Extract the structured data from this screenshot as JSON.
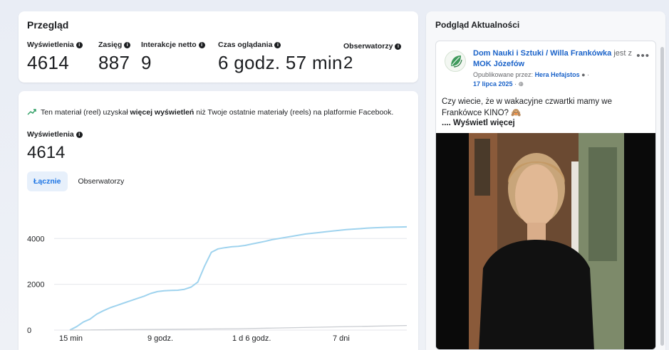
{
  "overview": {
    "title": "Przegląd",
    "metrics": [
      {
        "label": "Wyświetlenia",
        "value": "4614"
      },
      {
        "label": "Zasięg",
        "value": "887"
      },
      {
        "label": "Interakcje netto",
        "value": "9"
      },
      {
        "label": "Czas oglądania",
        "value": "6 godz. 57 min"
      },
      {
        "label": "Obserwatorzy",
        "value": "2"
      }
    ]
  },
  "insight": {
    "pre": "Ten materiał (reel) uzyskał",
    "bold": "więcej wyświetleń",
    "post": "niż Twoje ostatnie materiały (reels) na platformie Facebook."
  },
  "chart_section": {
    "label": "Wyświetlenia",
    "value": "4614",
    "tabs": [
      {
        "label": "Łącznie",
        "active": true
      },
      {
        "label": "Obserwatorzy",
        "active": false
      }
    ]
  },
  "chart_data": {
    "type": "line",
    "ylim": [
      0,
      4600
    ],
    "yticks": [
      0,
      2000,
      4000
    ],
    "xticks": [
      "15 min",
      "9 godz.",
      "1 d 6 godz.",
      "7 dni"
    ],
    "series": [
      {
        "color": "#9fd3ee",
        "x": [
          0,
          2,
          4,
          6,
          8,
          10,
          12,
          14,
          16,
          18,
          20,
          22,
          24,
          26,
          28,
          30,
          32,
          34,
          36,
          38,
          40,
          42,
          44,
          46,
          48,
          50,
          52,
          54,
          56,
          58,
          60,
          62,
          64,
          66,
          68,
          70,
          72,
          74,
          76,
          78,
          80,
          82,
          84,
          86,
          88,
          90,
          92,
          94,
          96,
          98,
          100
        ],
        "y": [
          0,
          150,
          350,
          480,
          700,
          850,
          980,
          1080,
          1180,
          1280,
          1380,
          1480,
          1600,
          1680,
          1720,
          1730,
          1740,
          1780,
          1880,
          2100,
          2800,
          3400,
          3550,
          3600,
          3640,
          3660,
          3700,
          3760,
          3820,
          3880,
          3950,
          4000,
          4050,
          4100,
          4150,
          4200,
          4230,
          4260,
          4300,
          4330,
          4360,
          4390,
          4410,
          4430,
          4450,
          4470,
          4480,
          4490,
          4500,
          4505,
          4510
        ]
      },
      {
        "color": "#c9ccd1",
        "x": [
          0,
          50,
          100
        ],
        "y": [
          0,
          60,
          200
        ]
      }
    ]
  },
  "preview": {
    "title": "Podgląd Aktualności",
    "page_name": "Dom Nauki i Sztuki / Willa Frankówka",
    "is_with": "jest z",
    "with_name": "MOK Józefów",
    "published_by_label": "Opublikowane przez:",
    "published_by": "Hera Hefajstos",
    "date": "17 lipca 2025",
    "post_text": "Czy wiecie, że w wakacyjne czwartki mamy we Frankówce KINO? 🙈",
    "see_more": ".... Wyświetl więcej"
  }
}
